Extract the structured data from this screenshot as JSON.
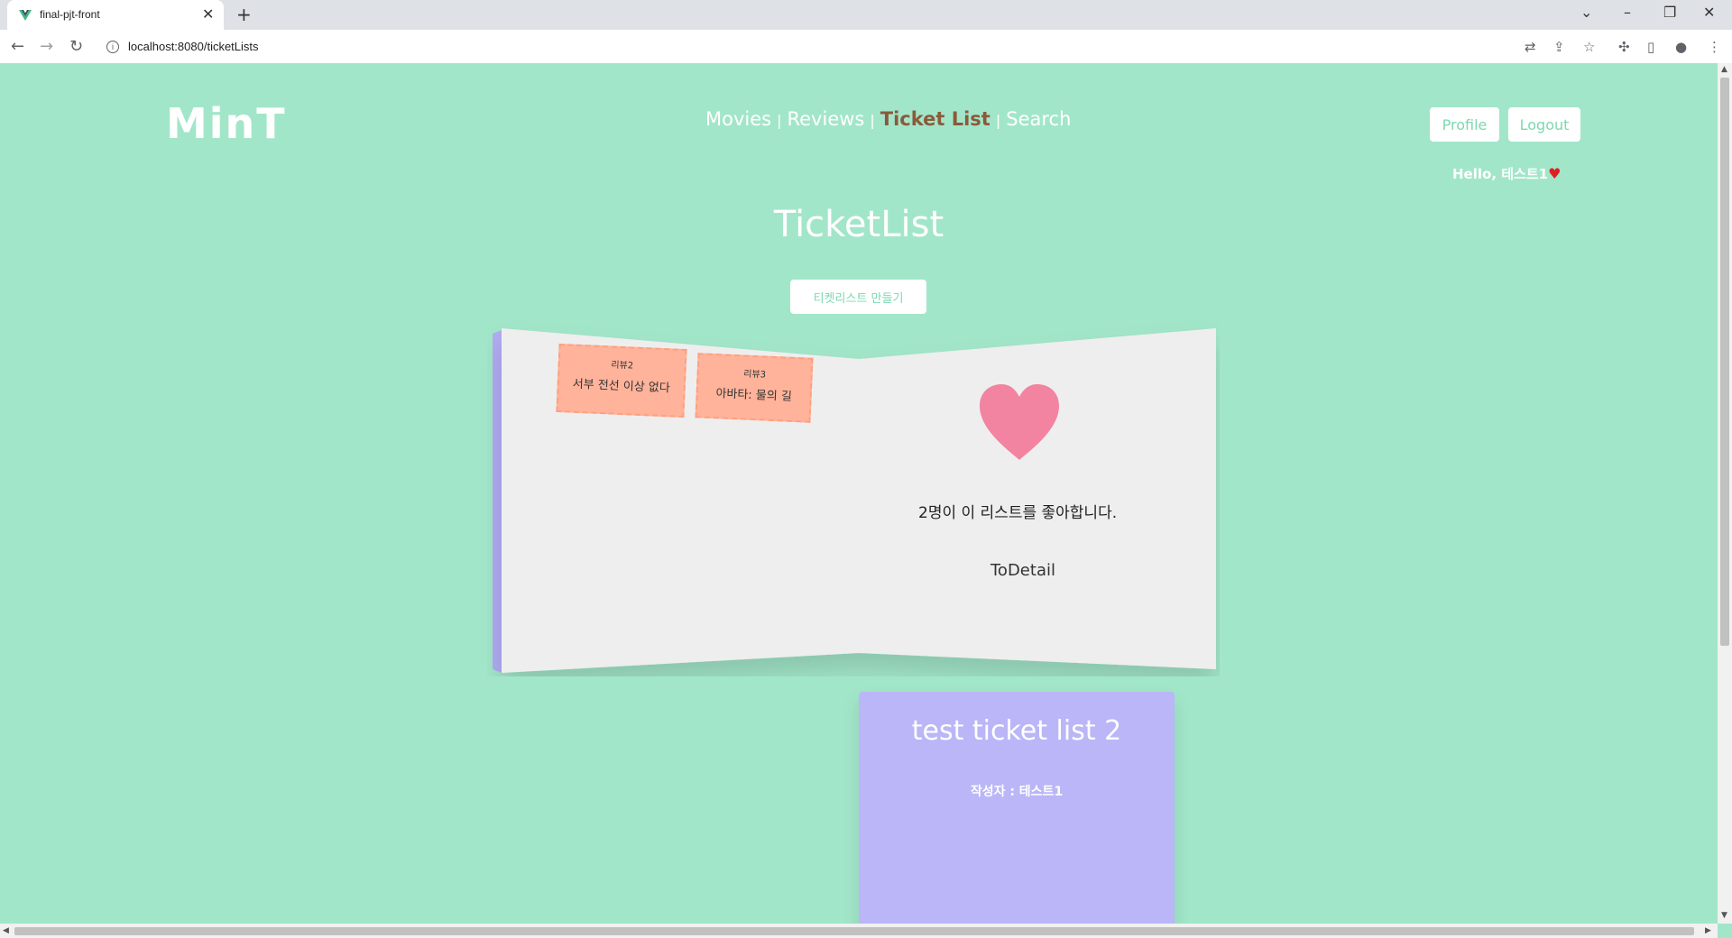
{
  "browser": {
    "tab_title": "final-pjt-front",
    "url": "localhost:8080/ticketLists"
  },
  "header": {
    "logo": "MinT",
    "nav": [
      {
        "label": "Movies"
      },
      {
        "label": "Reviews"
      },
      {
        "label": "Ticket List"
      },
      {
        "label": "Search"
      }
    ],
    "separator": "|",
    "profile_button": "Profile",
    "logout_button": "Logout",
    "greeting": "Hello, 테스트1",
    "greeting_heart": "♥"
  },
  "main": {
    "title": "TicketList",
    "make_button": "티켓리스트 만들기",
    "ticket_lists": [
      {
        "tickets": [
          {
            "review": "리뷰2",
            "movie": "서부 전선 이상 없다"
          },
          {
            "review": "리뷰3",
            "movie": "아바타: 물의 길"
          }
        ],
        "like_text": "2명이 이 리스트를 좋아합니다.",
        "detail_link": "ToDetail"
      },
      {
        "title": "test ticket list 2",
        "author": "작성자 : 테스트1"
      }
    ]
  },
  "colors": {
    "background": "#a2e6c9",
    "accent_text": "#7dd8b3",
    "active_nav": "#8a5a3c",
    "ticket": "#ffb39a",
    "heart": "#f283a1",
    "card_purple": "#bab6f7",
    "book_page": "#eeeeee"
  }
}
